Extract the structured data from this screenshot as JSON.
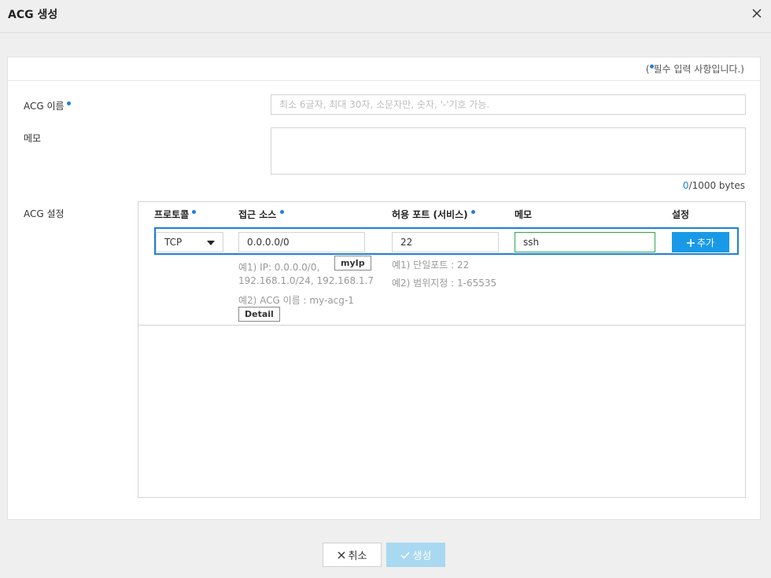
{
  "dialog": {
    "title": "ACG 생성",
    "required_note_prefix": "(",
    "required_note_text": "필수 입력 사항입니다.)"
  },
  "form": {
    "name_label": "ACG 이름",
    "name_placeholder": "최소 6글자, 최대 30자, 소문자만, 숫자, '-'기호 가능.",
    "memo_label": "메모",
    "byte_current": "0",
    "byte_total": "/1000 bytes",
    "acg_label": "ACG 설정"
  },
  "acg_table": {
    "headers": {
      "protocol": "프로토콜",
      "source": "접근 소스",
      "port": "허용 포트 (서비스)",
      "memo": "메모",
      "setting": "설정"
    },
    "row": {
      "protocol": "TCP",
      "source": "0.0.0.0/0",
      "port": "22",
      "memo": "ssh",
      "add_label": "추가"
    },
    "source_hints": {
      "line1": "예1) IP: 0.0.0.0/0,",
      "line2": "192.168.1.0/24, 192.168.1.7",
      "line3": "예2) ACG 이름 : my-acg-1",
      "myip_label": "myIp",
      "detail_label": "Detail"
    },
    "port_hints": {
      "line1": "예1) 단일포트 : 22",
      "line2": "예2) 범위지정 : 1-65535"
    }
  },
  "footer": {
    "cancel_label": "취소",
    "create_label": "생성"
  },
  "colors": {
    "accent": "#1f7fd6",
    "add_button": "#1a9ae6",
    "create_button_disabled": "#a9d8f1",
    "memo_border": "#2fa34a"
  },
  "icons": [
    "close-icon",
    "required-dot-icon",
    "chevron-down-icon",
    "plus-icon",
    "x-icon",
    "check-icon"
  ]
}
